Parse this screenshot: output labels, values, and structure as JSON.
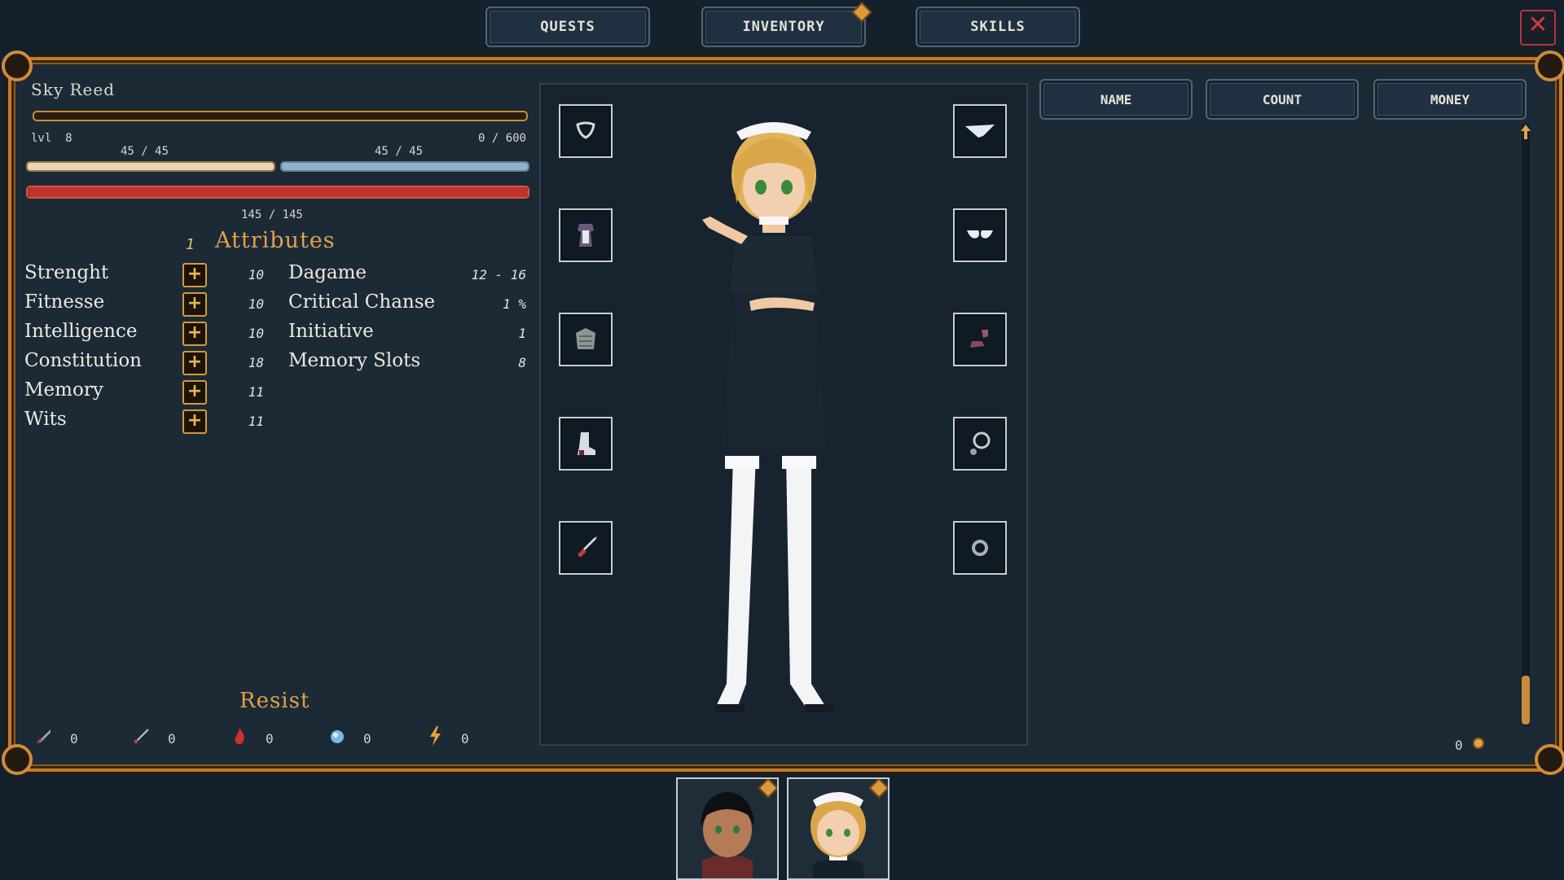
{
  "tabs": [
    {
      "label": "QUESTS"
    },
    {
      "label": "INVENTORY"
    },
    {
      "label": "SKILLS"
    }
  ],
  "close_label": "✕",
  "character": {
    "name": "Sky Reed",
    "level_label": "lvl",
    "level": "8",
    "experience": "0 / 600",
    "experience_fraction": 0,
    "stat_a": "45 / 45",
    "stat_b": "45 / 45",
    "health": "145 / 145",
    "health_fraction": 1.0
  },
  "attributes": {
    "points": "1",
    "title": "Attributes",
    "primary": [
      {
        "label": "Strenght",
        "value": "10"
      },
      {
        "label": "Fitnesse",
        "value": "10"
      },
      {
        "label": "Intelligence",
        "value": "10"
      },
      {
        "label": "Constitution",
        "value": "18"
      },
      {
        "label": "Memory",
        "value": "11"
      },
      {
        "label": "Wits",
        "value": "11"
      }
    ],
    "secondary": [
      {
        "label": "Dagame",
        "value": "12 - 16"
      },
      {
        "label": "Critical Chanse",
        "value": "1 %"
      },
      {
        "label": "Initiative",
        "value": "1"
      },
      {
        "label": "Memory Slots",
        "value": "8"
      }
    ]
  },
  "resist": {
    "title": "Resist",
    "items": [
      {
        "icon": "sword-icon",
        "value": "0"
      },
      {
        "icon": "arrow-icon",
        "value": "0"
      },
      {
        "icon": "fire-icon",
        "value": "0"
      },
      {
        "icon": "ice-icon",
        "value": "0"
      },
      {
        "icon": "lightning-icon",
        "value": "0"
      }
    ]
  },
  "equipment": {
    "left_slots": [
      "necklace-icon",
      "dress-icon",
      "armor-icon",
      "boot-icon",
      "dagger-icon"
    ],
    "right_slots": [
      "panties-icon",
      "bra-icon",
      "shoes-icon",
      "amulet-icon",
      "ring-icon"
    ]
  },
  "inventory": {
    "columns": [
      "NAME",
      "COUNT",
      "MONEY"
    ],
    "money": "0"
  },
  "party": [
    {
      "name": "dark-haired-hero-portrait"
    },
    {
      "name": "maid-portrait"
    }
  ],
  "colors": {
    "accent": "#e0a24a",
    "frame": "#c07c31",
    "health": "#c0322f",
    "panel": "#1c2a36"
  }
}
